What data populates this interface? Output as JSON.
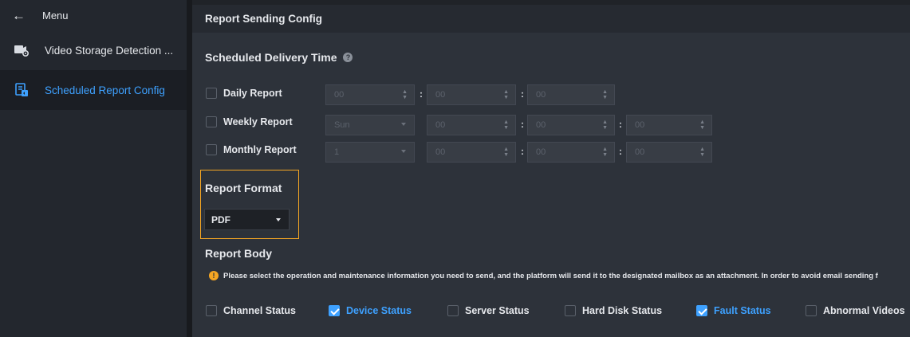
{
  "sidebar": {
    "menu_label": "Menu",
    "items": [
      {
        "label": "Video Storage Detection ...",
        "icon": "storage-detection-icon"
      },
      {
        "label": "Scheduled Report Config",
        "icon": "report-config-icon",
        "active": true
      }
    ]
  },
  "colors": {
    "accent": "#3ea1ff",
    "highlight": "#f5a623"
  },
  "header": {
    "title": "Report Sending Config"
  },
  "delivery": {
    "title": "Scheduled Delivery Time",
    "daily": {
      "label": "Daily Report",
      "h": "00",
      "m": "00",
      "s": "00"
    },
    "weekly": {
      "label": "Weekly Report",
      "day": "Sun",
      "h": "00",
      "m": "00",
      "s": "00"
    },
    "monthly": {
      "label": "Monthly Report",
      "day": "1",
      "h": "00",
      "m": "00",
      "s": "00"
    },
    "colon": ":"
  },
  "format": {
    "title": "Report Format",
    "value": "PDF"
  },
  "body": {
    "title": "Report Body",
    "notice": "Please select the operation and maintenance information you need to send, and the platform will send it to the designated mailbox as an attachment. In order to avoid email sending f",
    "options": [
      {
        "label": "Channel Status",
        "checked": false
      },
      {
        "label": "Device Status",
        "checked": true
      },
      {
        "label": "Server Status",
        "checked": false
      },
      {
        "label": "Hard Disk Status",
        "checked": false
      },
      {
        "label": "Fault Status",
        "checked": true
      },
      {
        "label": "Abnormal Videos",
        "checked": false
      }
    ]
  }
}
